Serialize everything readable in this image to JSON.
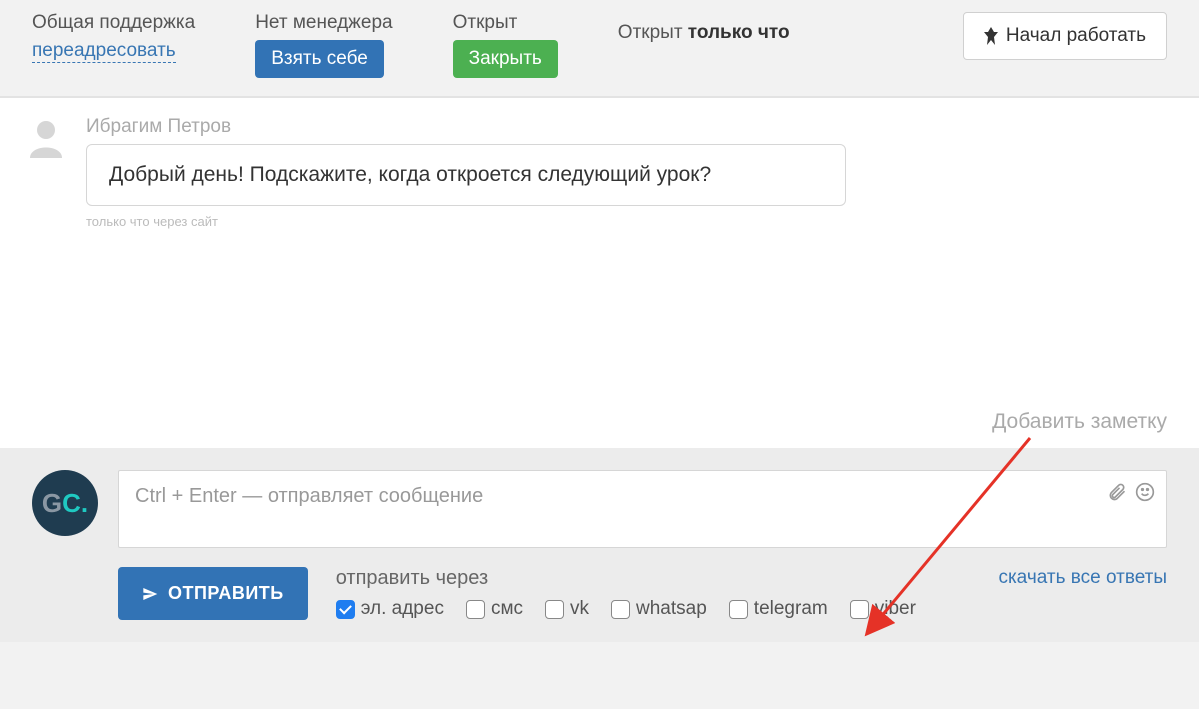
{
  "topbar": {
    "support": {
      "label": "Общая поддержка",
      "link": "переадресовать"
    },
    "manager": {
      "label": "Нет менеджера",
      "button": "Взять себе"
    },
    "status": {
      "label": "Открыт",
      "button": "Закрыть"
    },
    "opened": {
      "prefix": "Открыт ",
      "bold": "только что"
    },
    "start_work": "Начал работать"
  },
  "conversation": {
    "user_name": "Ибрагим Петров",
    "message": "Добрый день! Подскажите, когда откроется следующий урок?",
    "meta": "только что через сайт",
    "add_note": "Добавить заметку"
  },
  "compose": {
    "avatar": {
      "g": "G",
      "c": "C",
      "dot": "."
    },
    "placeholder": "Ctrl + Enter — отправляет сообщение",
    "send": "ОТПРАВИТЬ",
    "channels_label": "отправить через",
    "download": "скачать все ответы",
    "channels": [
      {
        "label": "эл. адрес",
        "checked": true
      },
      {
        "label": "смс",
        "checked": false
      },
      {
        "label": "vk",
        "checked": false
      },
      {
        "label": "whatsap",
        "checked": false
      },
      {
        "label": "telegram",
        "checked": false
      },
      {
        "label": "viber",
        "checked": false
      }
    ]
  }
}
